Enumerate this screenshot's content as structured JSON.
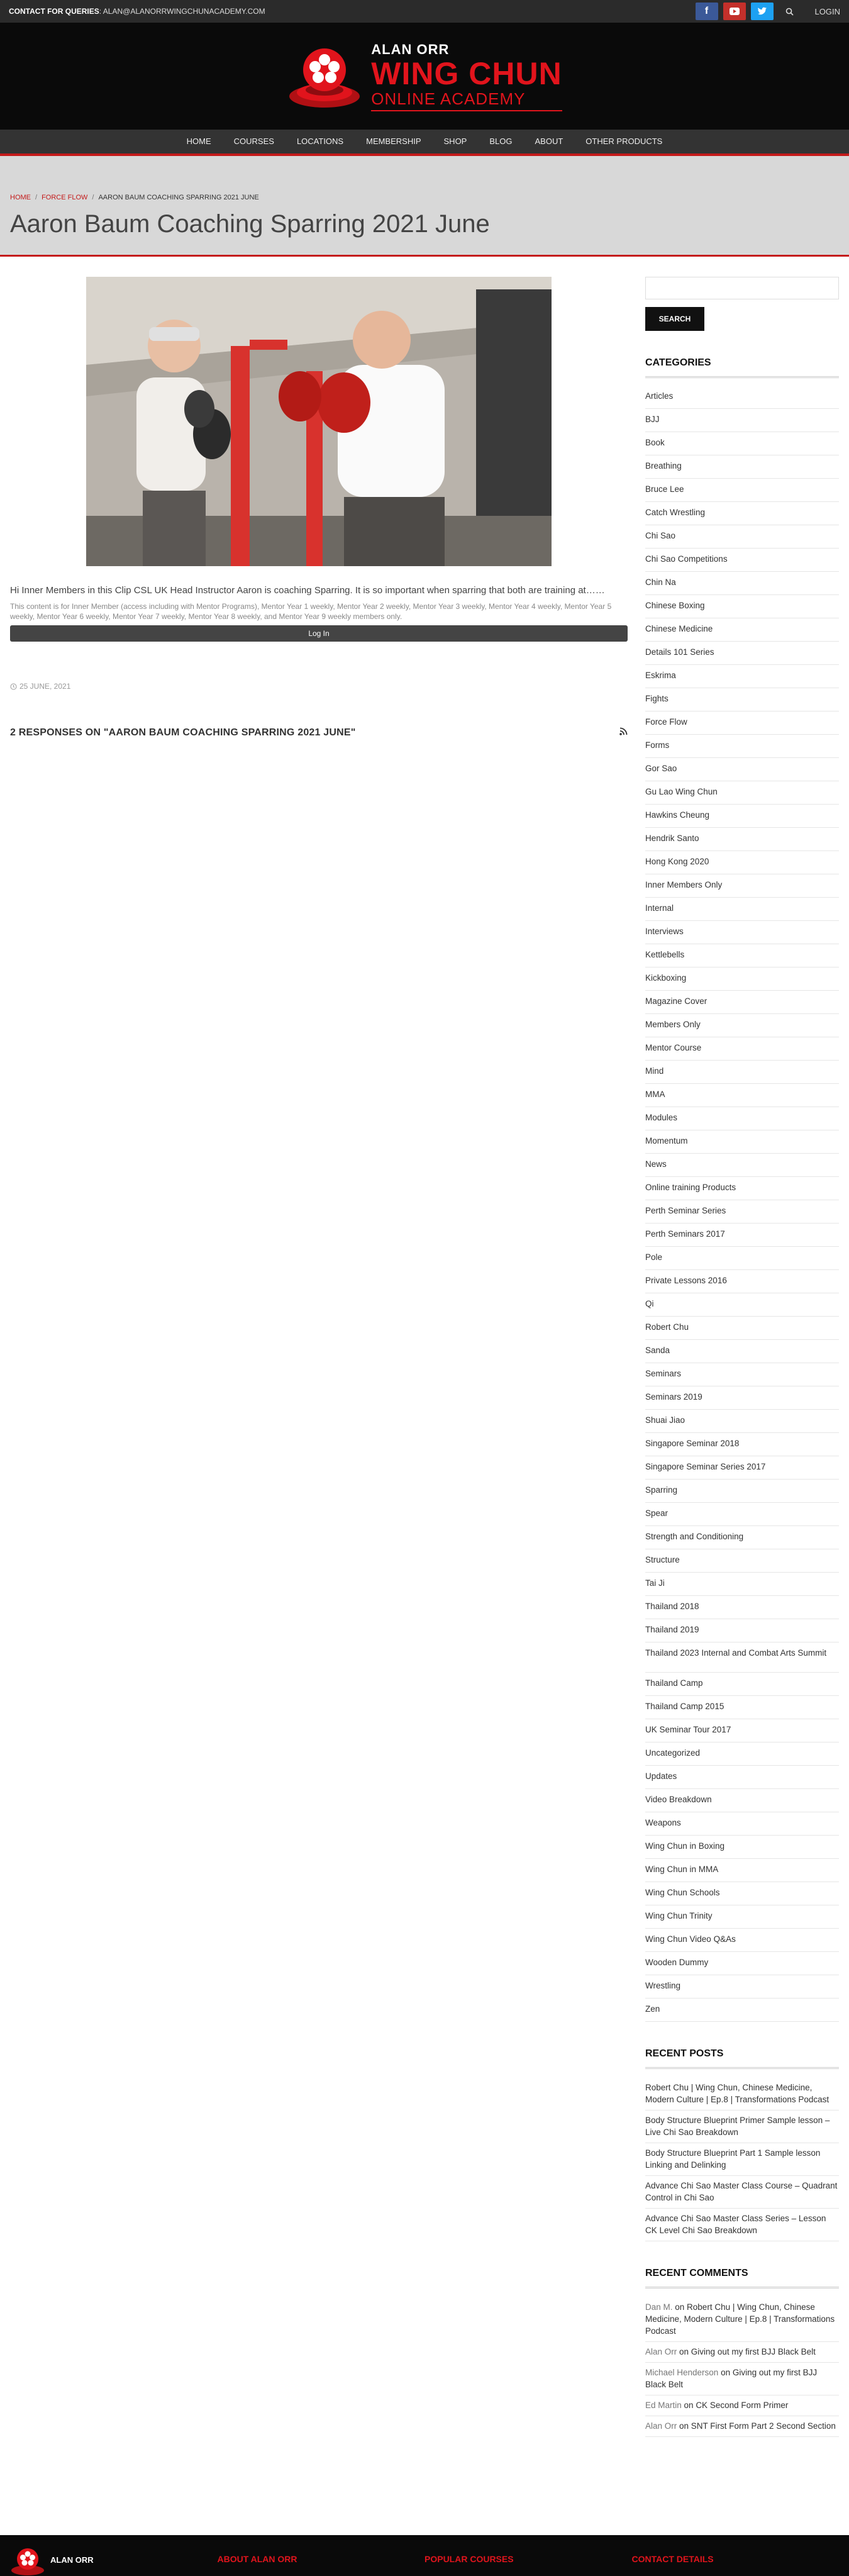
{
  "topbar": {
    "contact_label": "CONTACT FOR QUERIES",
    "contact_email": ": ALAN@ALANORRWINGCHUNACADEMY.COM",
    "login": "LOGIN"
  },
  "header": {
    "logo_line1": "ALAN ORR",
    "logo_line2": "WING CHUN",
    "logo_line3": "ONLINE ACADEMY"
  },
  "nav": [
    "HOME",
    "COURSES",
    "LOCATIONS",
    "MEMBERSHIP",
    "SHOP",
    "BLOG",
    "ABOUT",
    "OTHER PRODUCTS"
  ],
  "breadcrumb": {
    "home": "HOME",
    "category": "FORCE FLOW",
    "current": "AARON BAUM COACHING SPARRING 2021 JUNE"
  },
  "page_title": "Aaron Baum Coaching Sparring 2021 June",
  "post": {
    "excerpt": "Hi Inner Members in this Clip CSL UK Head Instructor Aaron is coaching Sparring. It is so important when sparring that both are training at……",
    "restriction": "This content is for Inner Member (access including with Mentor Programs), Mentor Year 1 weekly, Mentor Year 2 weekly, Mentor Year 3 weekly, Mentor Year 4 weekly, Mentor Year 5 weekly, Mentor Year 6 weekly, Mentor Year 7 weekly, Mentor Year 8 weekly, and Mentor Year 9 weekly members only.",
    "login_button": "Log In",
    "date": "25 JUNE, 2021",
    "responses": "2 RESPONSES ON \"AARON BAUM COACHING SPARRING 2021 JUNE\""
  },
  "sidebar": {
    "search_placeholder": "",
    "search_button": "SEARCH",
    "categories_title": "CATEGORIES",
    "categories": [
      "Articles",
      "BJJ",
      "Book",
      "Breathing",
      "Bruce Lee",
      "Catch Wrestling",
      "Chi Sao",
      "Chi Sao Competitions",
      "Chin Na",
      "Chinese Boxing",
      "Chinese Medicine",
      "Details 101 Series",
      "Eskrima",
      "Fights",
      "Force Flow",
      "Forms",
      "Gor Sao",
      "Gu Lao Wing Chun",
      "Hawkins Cheung",
      "Hendrik Santo",
      "Hong Kong 2020",
      "Inner Members Only",
      "Internal",
      "Interviews",
      "Kettlebells",
      "Kickboxing",
      "Magazine Cover",
      "Members Only",
      "Mentor Course",
      "Mind",
      "MMA",
      "Modules",
      "Momentum",
      "News",
      "Online training Products",
      "Perth Seminar Series",
      "Perth Seminars 2017",
      "Pole",
      "Private Lessons 2016",
      "Qi",
      "Robert Chu",
      "Sanda",
      "Seminars",
      "Seminars 2019",
      "Shuai Jiao",
      "Singapore Seminar 2018",
      "Singapore Seminar Series 2017",
      "Sparring",
      "Spear",
      "Strength and Conditioning",
      "Structure",
      "Tai Ji",
      "Thailand 2018",
      "Thailand 2019",
      "Thailand 2023 Internal and Combat Arts Summit",
      "Thailand Camp",
      "Thailand Camp 2015",
      "UK Seminar Tour 2017",
      "Uncategorized",
      "Updates",
      "Video Breakdown",
      "Weapons",
      "Wing Chun in Boxing",
      "Wing Chun in MMA",
      "Wing Chun Schools",
      "Wing Chun Trinity",
      "Wing Chun Video Q&As",
      "Wooden Dummy",
      "Wrestling",
      "Zen"
    ],
    "recent_posts_title": "RECENT POSTS",
    "recent_posts": [
      "Robert Chu | Wing Chun, Chinese Medicine, Modern Culture | Ep.8 | Transformations Podcast",
      "Body Structure Blueprint Primer Sample lesson – Live Chi Sao Breakdown",
      "Body Structure Blueprint Part 1 Sample lesson Linking and Delinking",
      "Advance Chi Sao Master Class Course – Quadrant Control in Chi Sao",
      "Advance Chi Sao Master Class Series – Lesson CK Level Chi Sao Breakdown"
    ],
    "recent_comments_title": "RECENT COMMENTS",
    "recent_comments": [
      {
        "author": "Dan M.",
        "on": " on ",
        "post": "Robert Chu | Wing Chun, Chinese Medicine, Modern Culture | Ep.8 | Transformations Podcast"
      },
      {
        "author": "Alan Orr",
        "on": " on ",
        "post": "Giving out my first BJJ Black Belt"
      },
      {
        "author": "Michael Henderson",
        "on": " on ",
        "post": "Giving out my first BJJ Black Belt"
      },
      {
        "author": "Ed Martin",
        "on": " on ",
        "post": "CK Second Form Primer"
      },
      {
        "author": "Alan Orr",
        "on": " on ",
        "post": "SNT First Form Part 2 Second Section"
      }
    ]
  },
  "footer": {
    "logo_text": "ALAN ORR",
    "col1": "ABOUT ALAN ORR",
    "col2": "POPULAR COURSES",
    "col3": "CONTACT DETAILS"
  },
  "colors": {
    "accent": "#c41a1a",
    "brand_red": "#e1141c",
    "dark": "#0a0a0a"
  }
}
